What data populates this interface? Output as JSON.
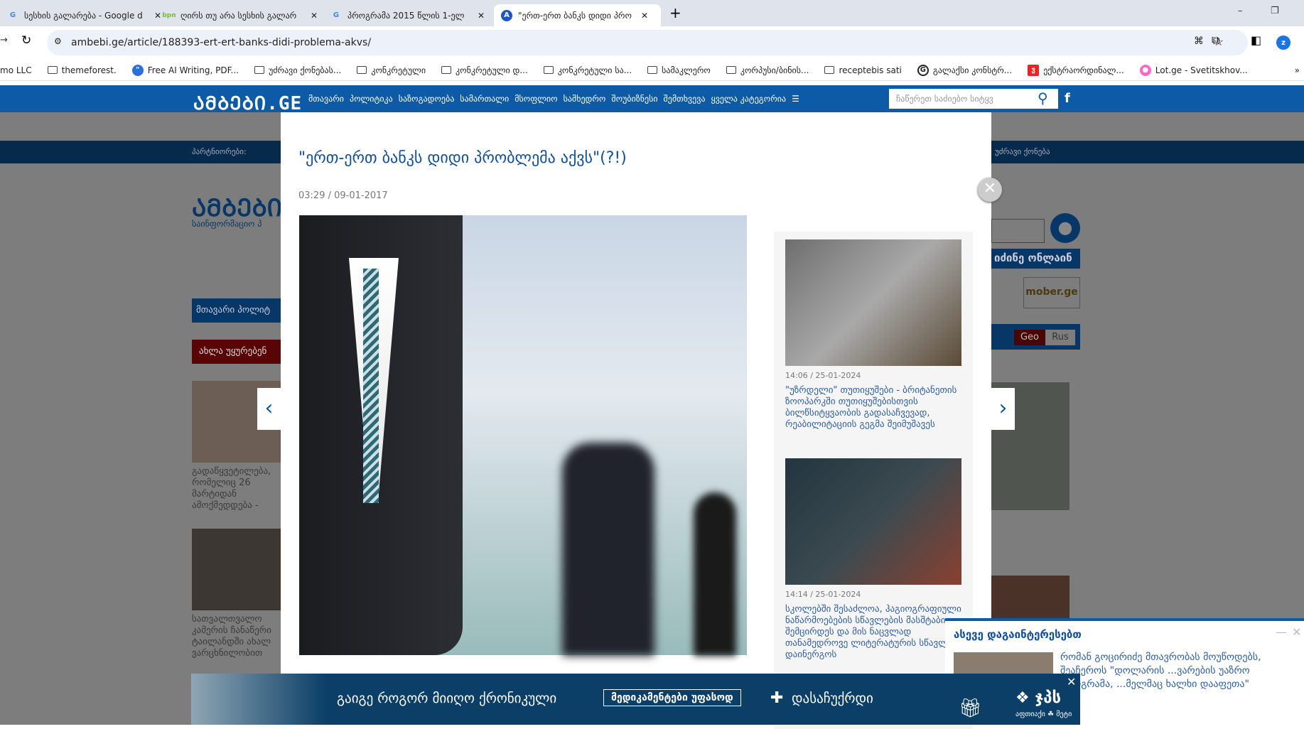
{
  "browser": {
    "tabs": [
      {
        "title": "სესხის გალარება - Google d",
        "icon": "google-icon"
      },
      {
        "title": "ღირს თუ არა სესხის გალარ",
        "icon": "bpn-icon"
      },
      {
        "title": "პროგრამა 2015 წლის 1-ელ",
        "icon": "google-icon"
      },
      {
        "title": "\"ერთ-ერთ ბანკს დიდი პრო",
        "icon": "ambebi-icon",
        "active": true
      }
    ],
    "url": "ambebi.ge/article/188393-ert-ert-banks-didi-problema-akvs/",
    "profile": "z",
    "bookmarks": [
      "mo LLC",
      "themeforest.",
      "Free AI Writing, PDF...",
      "უძრავი ქონებას...",
      "კონკრეტული",
      "კონკრეტული დ...",
      "კონკრეტული სა...",
      "სამაკლერო",
      "კორპუსი/ბინის...",
      "receptebis sati",
      "გალაქსი კონსტრ...",
      "ექსტრაორდინალ...",
      "Lot.ge - Svetitskhov..."
    ]
  },
  "site": {
    "logo": "ᲐᲛᲑᲔᲑᲘ.GE",
    "nav": [
      "მთავარი",
      "პოლიტიკა",
      "საზოგადოება",
      "სამართალი",
      "მსოფლიო",
      "სამხედრო",
      "შოუბიზნესი",
      "შემთხვევა",
      "ყველა კატეგორია"
    ],
    "search_placeholder": "ჩაწერეთ საძიებო სიტყვ",
    "partners_label": "პარტნიორები:",
    "partners_right": "უძრავი ქონება",
    "tagline": "საინფორმაციო პ",
    "menu_left": "მთავარი  პოლიტ",
    "now_watching": "ახლა უყურებენ",
    "left_items": [
      "გადაწყვეტილება, რომელიც 26 მარტიდან ამოქმედდება -",
      "სათვალთვალო კამერის ჩანაწერი ტაილანდში ახალ ვარცხნილობით"
    ],
    "shop_online": "იძინე ონლაინ",
    "lang": [
      "Geo",
      "Rus"
    ],
    "mober": "mober.ge"
  },
  "modal": {
    "title": "\"ერთ-ერთ ბანკს დიდი პრობლემა აქვს\"(?!)",
    "date": "03:29 / 09-01-2017",
    "related": [
      {
        "date": "14:06 / 25-01-2024",
        "title": "\"უზრდელი\" თუთიყუშები - ბრიტანეთის ზოოპარკში თუთიყუშებისთვის ბილწსიტყვაობის გადასაჩვევად, რეაბილიტაციის გეგმა შეიმუშავეს"
      },
      {
        "date": "14:14 / 25-01-2024",
        "title": "სკოლებში შესაძლოა, ჰაგიოგრაფიული ნაწარმოებების სწავლების მასშტაბი შემცირდეს და მის ნაცვლად თანამედროვე ლიტერატურის სწავლება დაინერგოს"
      }
    ]
  },
  "ad": {
    "text": "გაიგე როგორ მიიღო ქრონიკული",
    "button": "მედიკამენტები უფასოდ",
    "plus": "დასაჩუქრდი",
    "brand": "ჯპს",
    "brand_sub": "აფთიაქი ☘ მეტი"
  },
  "popup": {
    "heading": "ასევე დაგაინტერესებთ",
    "text": "რომან გოცირიძე მთავრობას მოუწოდებს, შეაჩეროს \"დოლარის ...ვარების უაზრო პროგრამა, ...მელმაც ხალხი დააფეთა\""
  },
  "colors": {
    "brand": "#0d5aa7",
    "dark": "#062a4c",
    "ad": "#0b3f67"
  }
}
